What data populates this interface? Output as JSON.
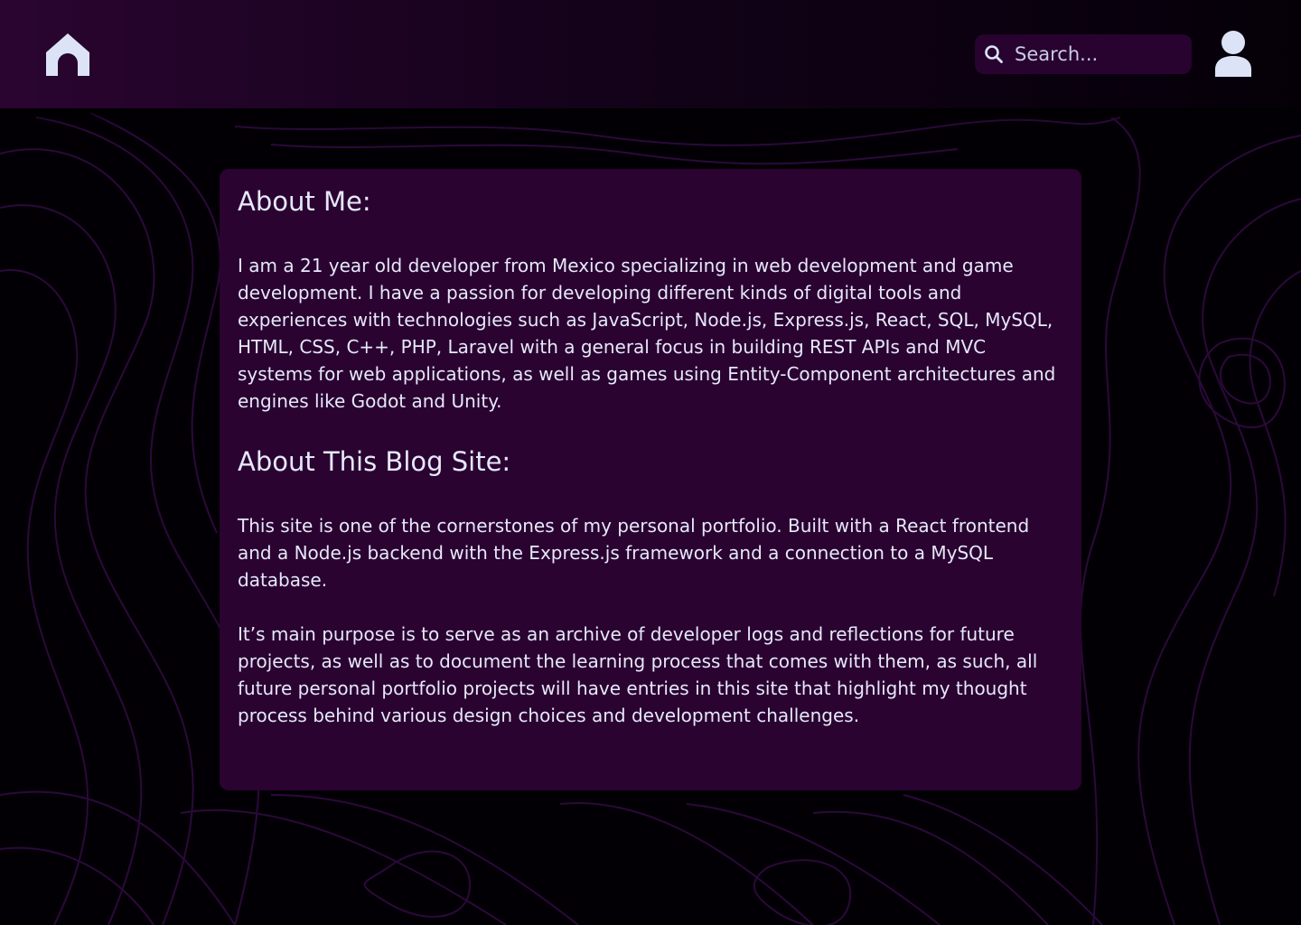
{
  "nav": {
    "home_icon": "home-icon",
    "search": {
      "icon": "search-icon",
      "placeholder": "Search...",
      "value": ""
    },
    "user_icon": "user-icon"
  },
  "about": {
    "heading": "About Me:",
    "body": "I am a 21 year old developer from Mexico specializing in web development and game development. I have a passion for developing different kinds of digital tools and experiences with technologies such as JavaScript, Node.js, Express.js, React, SQL, MySQL, HTML, CSS, C++, PHP, Laravel with a general focus in building REST APIs and MVC systems for web applications, as well as games using Entity-Component architectures and engines like Godot and Unity."
  },
  "blog": {
    "heading": "About This Blog Site:",
    "paragraphs": [
      "This site is one of the cornerstones of my personal portfolio. Built with a React frontend and a Node.js backend with the Express.js framework and a connection to a MySQL database.",
      "It’s main purpose is to serve as an archive of developer logs and reflections for future projects, as well as to document the learning process that comes with them, as such, all future personal portfolio projects will have entries in this site that highlight my thought process behind various design choices and development challenges."
    ]
  },
  "colors": {
    "background": "#030005",
    "navbar_start": "#2a0530",
    "card": "#2a0330",
    "search_field": "#28032f",
    "text": "#e6e8fa",
    "icon": "#dde3f7",
    "contour_lines": "#2b0a3a"
  }
}
